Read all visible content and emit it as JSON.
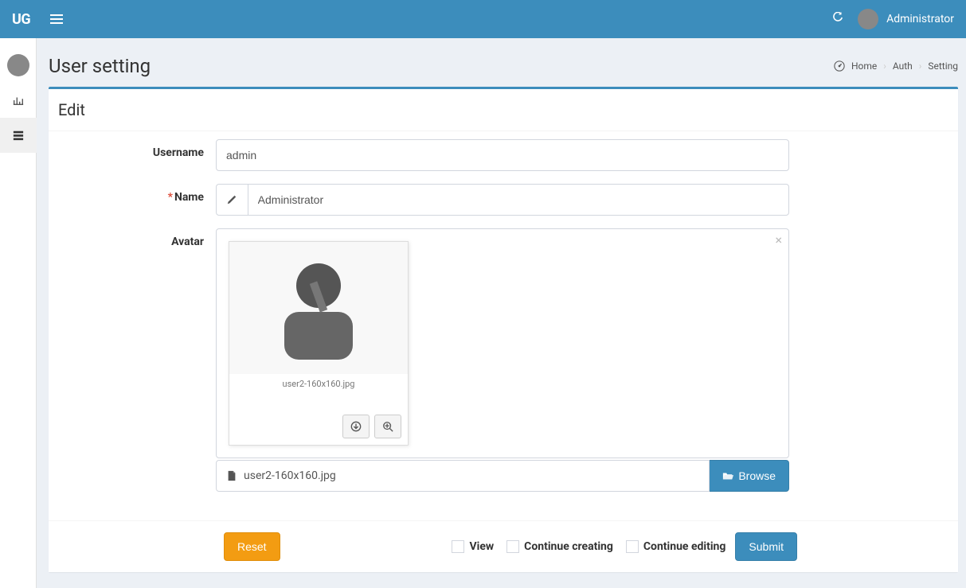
{
  "header": {
    "logo": "UG",
    "user_name": "Administrator"
  },
  "page": {
    "title": "User setting"
  },
  "breadcrumb": {
    "home": "Home",
    "auth": "Auth",
    "setting": "Setting"
  },
  "box": {
    "header": "Edit"
  },
  "form": {
    "username_label": "Username",
    "username_value": "admin",
    "name_label": "Name",
    "name_value": "Administrator",
    "avatar_label": "Avatar",
    "avatar_filename": "user2-160x160.jpg",
    "file_caption": "user2-160x160.jpg",
    "browse": "Browse"
  },
  "footer": {
    "reset": "Reset",
    "view": "View",
    "continue_creating": "Continue creating",
    "continue_editing": "Continue editing",
    "submit": "Submit"
  }
}
